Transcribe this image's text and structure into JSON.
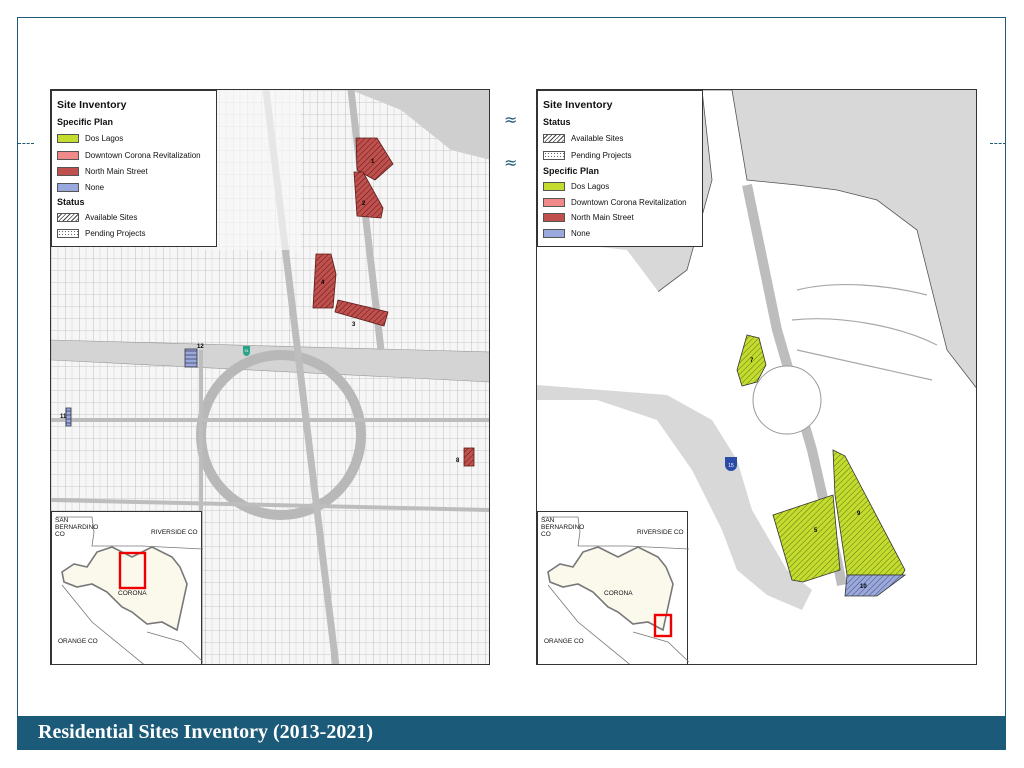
{
  "footer": {
    "title": "Residential Sites Inventory (2013-2021)"
  },
  "colors": {
    "dos_lagos": "#c4dc2e",
    "downtown_corona_revitalization": "#f08a8a",
    "north_main_street": "#c0504d",
    "none": "#99a8dd",
    "banner": "#1b5a78"
  },
  "left_map": {
    "legend": {
      "title": "Site Inventory",
      "specific_plan_heading": "Specific Plan",
      "specific_plan_items": [
        "Dos Lagos",
        "Downtown Corona Revitalization",
        "North Main Street",
        "None"
      ],
      "status_heading": "Status",
      "status_items": [
        "Available Sites",
        "Pending Projects"
      ]
    },
    "site_labels": [
      "1",
      "2",
      "3",
      "4",
      "8",
      "11",
      "12"
    ],
    "highway_shield": "91",
    "inset": {
      "labels": [
        "SAN",
        "BERNARDINO",
        "CO",
        "RIVERSIDE CO",
        "CORONA",
        "ORANGE CO"
      ]
    }
  },
  "right_map": {
    "legend": {
      "title": "Site Inventory",
      "status_heading": "Status",
      "status_items": [
        "Available Sites",
        "Pending Projects"
      ],
      "specific_plan_heading": "Specific Plan",
      "specific_plan_items": [
        "Dos Lagos",
        "Downtown Corona Revitalization",
        "North Main Street",
        "None"
      ]
    },
    "site_labels": [
      "7",
      "9",
      "5",
      "10"
    ],
    "highway_shield": "15",
    "inset": {
      "labels": [
        "SAN",
        "BERNARDINO",
        "CO",
        "RIVERSIDE CO",
        "CORONA",
        "ORANGE CO"
      ]
    }
  }
}
